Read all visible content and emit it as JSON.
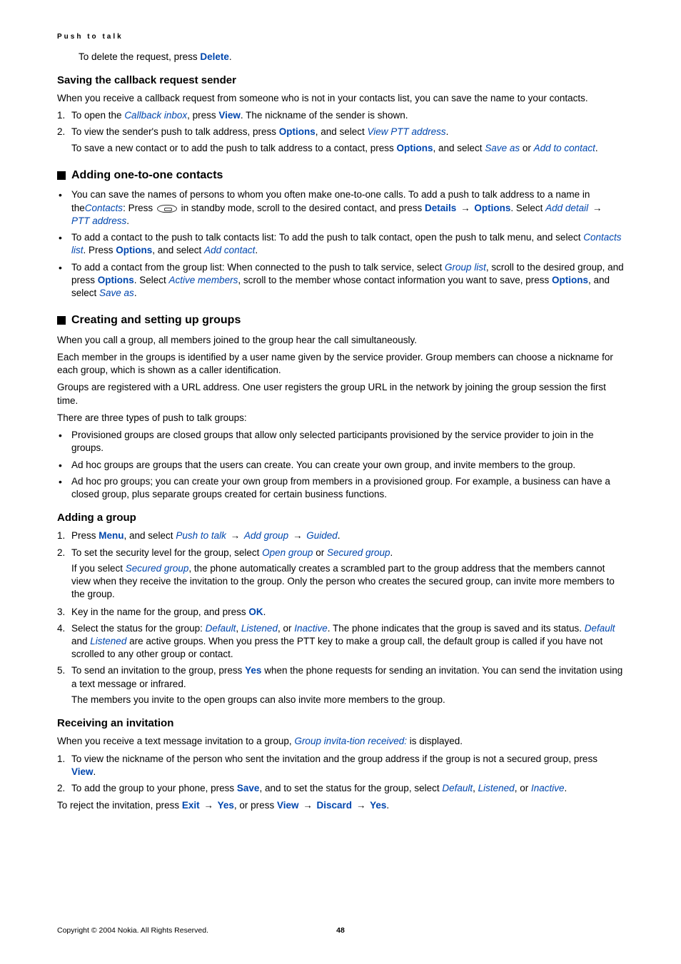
{
  "header": "Push to talk",
  "intro_line": {
    "t1": "To delete the request, press ",
    "k1": "Delete",
    "t2": "."
  },
  "saving": {
    "title": "Saving the callback request sender",
    "p1": "When you receive a callback request from someone who is not in your contacts list, you can save the name to your contacts.",
    "li1": {
      "a": "To open the ",
      "b": "Callback inbox",
      "c": ", press ",
      "d": "View",
      "e": ". The nickname of the sender is shown."
    },
    "li2": {
      "a": "To view the sender's push to talk address, press ",
      "b": "Options",
      "c": ", and select ",
      "d": "View PTT address",
      "e": "."
    },
    "li2sub": {
      "a": "To save a new contact or to add the push to talk address to a contact, press ",
      "b": "Options",
      "c": ", and select ",
      "d": "Save as",
      "e": " or ",
      "f": "Add to contact",
      "g": "."
    }
  },
  "adding": {
    "title": "Adding one-to-one contacts",
    "b1": {
      "a": "You can save the names of persons to whom you often make one-to-one calls. To add a push to talk address to a name in the",
      "b": "Contacts",
      "c": ": Press ",
      "d": " in standby mode, scroll to the desired contact, and press ",
      "e": "Details",
      "arr1": "→",
      "f": "Options",
      "g": ". Select ",
      "h": "Add detail",
      "arr2": "→",
      "i": "PTT address",
      "j": "."
    },
    "b2": {
      "a": "To add a contact to the push to talk contacts list: To add the push to talk contact, open the push to talk menu, and select ",
      "b": "Contacts list",
      "c": ". Press ",
      "d": "Options",
      "e": ", and select ",
      "f": "Add contact",
      "g": "."
    },
    "b3": {
      "a": "To add a contact from the group list: When connected to the push to talk service, select ",
      "b": "Group list",
      "c": ", scroll to the desired group, and press ",
      "d": "Options",
      "e": ". Select ",
      "f": "Active members",
      "g": ", scroll to the member whose contact information you want to save, press ",
      "h": "Options",
      "i": ", and select ",
      "j": "Save as",
      "k": "."
    }
  },
  "groups": {
    "title": "Creating and setting up groups",
    "p1": "When you call a group, all members joined to the group hear the call simultaneously.",
    "p2": "Each member in the groups is identified by a user name given by the service provider. Group members can choose a nickname for each group, which is shown as a caller identification.",
    "p3": "Groups are registered with a URL address. One user registers the group URL in the network by joining the group session the first time.",
    "p4": "There are three types of push to talk groups:",
    "gb1": "Provisioned groups are closed groups that allow only selected participants provisioned by the service provider to join in the groups.",
    "gb2": "Ad hoc groups are groups that the users can create. You can create your own group, and invite members to the group.",
    "gb3": "Ad hoc pro groups; you can create your own group from members in a provisioned group. For example, a business can have a closed group, plus separate groups created for certain business functions."
  },
  "addgroup": {
    "title": "Adding a group",
    "s1": {
      "a": "Press ",
      "b": "Menu",
      "c": ", and select ",
      "d": "Push to talk",
      "arr1": "→",
      "e": "Add group",
      "arr2": "→",
      "f": "Guided",
      "g": "."
    },
    "s2": {
      "a": "To set the security level for the group, select ",
      "b": "Open group",
      "c": " or ",
      "d": "Secured group",
      "e": "."
    },
    "s2sub": {
      "a": "If you select ",
      "b": "Secured group",
      "c": ", the phone automatically creates a scrambled part to the group address that the members cannot view when they receive the invitation to the group. Only the person who creates the secured group, can invite more members to the group."
    },
    "s3": {
      "a": "Key in the name for the group, and press ",
      "b": "OK",
      "c": "."
    },
    "s4": {
      "a": "Select the status for the group: ",
      "b": "Default",
      "c": ", ",
      "d": "Listened",
      "e": ", or ",
      "f": "Inactive",
      "g": ". The phone indicates that the group is saved and its status. ",
      "h": "Default",
      "i": " and ",
      "j": "Listened",
      "k": " are active groups. When you press the PTT key to make a group call, the default group is called if you have not scrolled to any other group or contact."
    },
    "s5": {
      "a": "To send an invitation to the group, press ",
      "b": "Yes",
      "c": " when the phone requests for sending an invitation. You can send the invitation using a text message or infrared."
    },
    "s5sub": "The members you invite to the open groups can also invite more members to the group."
  },
  "recv": {
    "title": "Receiving an invitation",
    "p1": {
      "a": "When you receive a text message invitation to a group, ",
      "b": "Group invita-tion received:",
      "c": " is displayed."
    },
    "s1": {
      "a": "To view the nickname of the person who sent the invitation and the group address if the group is not a secured group, press ",
      "b": "View",
      "c": "."
    },
    "s2": {
      "a": "To add the group to your phone, press ",
      "b": "Save",
      "c": ", and to set the status for the group, select ",
      "d": "Default",
      "e": ", ",
      "f": "Listened",
      "g": ", or ",
      "h": "Inactive",
      "i": "."
    },
    "reject": {
      "a": "To reject the invitation, press ",
      "b": "Exit",
      "arr1": "→",
      "c": "Yes",
      "d": ", or press ",
      "e": "View",
      "arr2": "→",
      "f": "Discard",
      "arr3": "→",
      "g": "Yes",
      "h": "."
    }
  },
  "footer": {
    "copy": "Copyright © 2004 Nokia. All Rights Reserved.",
    "page": "48"
  }
}
